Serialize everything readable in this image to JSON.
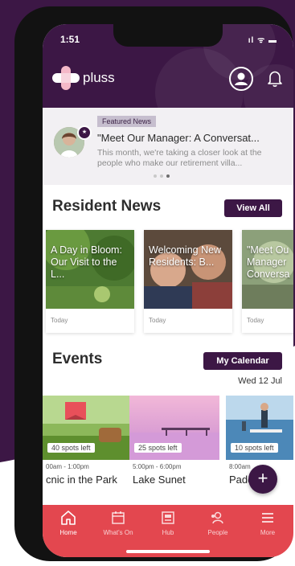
{
  "status_bar": {
    "time": "1:51",
    "icons": "ıl ᯤ ▬"
  },
  "header": {
    "app_name": "pluss"
  },
  "featured": {
    "badge": "Featured News",
    "title": "\"Meet Our Manager: A Conversat...",
    "body": "This month, we're taking a closer look at the people who make our retirement villa..."
  },
  "resident_news": {
    "title": "Resident News",
    "view_all": "View All",
    "cards": [
      {
        "caption": "A Day in Bloom: Our Visit to the L...",
        "date": "Today"
      },
      {
        "caption": "Welcoming New Residents: B...",
        "date": "Today"
      },
      {
        "caption": "\"Meet Ou Manager Conversa",
        "date": "Today"
      }
    ]
  },
  "events": {
    "title": "Events",
    "calendar_button": "My Calendar",
    "date": "Wed 12 Jul",
    "cards": [
      {
        "spots": "40 spots left",
        "time": "00am - 1:00pm",
        "title": "cnic in the Park"
      },
      {
        "spots": "25 spots left",
        "time": "5:00pm - 6:00pm",
        "title": "Lake Sunet"
      },
      {
        "spots": "10 spots left",
        "time": "8:00am",
        "title": "Paddl"
      }
    ]
  },
  "fab": {
    "label": "+"
  },
  "tabs": [
    {
      "label": "Home",
      "icon": "home-icon",
      "active": true
    },
    {
      "label": "What's On",
      "icon": "calendar-icon",
      "active": false
    },
    {
      "label": "Hub",
      "icon": "hub-icon",
      "active": false
    },
    {
      "label": "People",
      "icon": "people-icon",
      "active": false
    },
    {
      "label": "More",
      "icon": "menu-icon",
      "active": false
    }
  ],
  "colors": {
    "brand_purple": "#3c1745",
    "tab_red": "#e3474f",
    "badge_bg": "#c6bece"
  }
}
